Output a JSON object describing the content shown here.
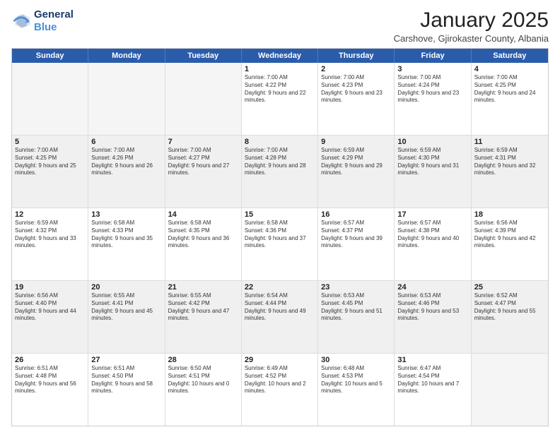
{
  "logo": {
    "line1": "General",
    "line2": "Blue"
  },
  "header": {
    "month": "January 2025",
    "location": "Carshove, Gjirokaster County, Albania"
  },
  "weekdays": [
    "Sunday",
    "Monday",
    "Tuesday",
    "Wednesday",
    "Thursday",
    "Friday",
    "Saturday"
  ],
  "rows": [
    [
      {
        "day": "",
        "info": "",
        "empty": true
      },
      {
        "day": "",
        "info": "",
        "empty": true
      },
      {
        "day": "",
        "info": "",
        "empty": true
      },
      {
        "day": "1",
        "info": "Sunrise: 7:00 AM\nSunset: 4:22 PM\nDaylight: 9 hours and 22 minutes."
      },
      {
        "day": "2",
        "info": "Sunrise: 7:00 AM\nSunset: 4:23 PM\nDaylight: 9 hours and 23 minutes."
      },
      {
        "day": "3",
        "info": "Sunrise: 7:00 AM\nSunset: 4:24 PM\nDaylight: 9 hours and 23 minutes."
      },
      {
        "day": "4",
        "info": "Sunrise: 7:00 AM\nSunset: 4:25 PM\nDaylight: 9 hours and 24 minutes."
      }
    ],
    [
      {
        "day": "5",
        "info": "Sunrise: 7:00 AM\nSunset: 4:25 PM\nDaylight: 9 hours and 25 minutes."
      },
      {
        "day": "6",
        "info": "Sunrise: 7:00 AM\nSunset: 4:26 PM\nDaylight: 9 hours and 26 minutes."
      },
      {
        "day": "7",
        "info": "Sunrise: 7:00 AM\nSunset: 4:27 PM\nDaylight: 9 hours and 27 minutes."
      },
      {
        "day": "8",
        "info": "Sunrise: 7:00 AM\nSunset: 4:28 PM\nDaylight: 9 hours and 28 minutes."
      },
      {
        "day": "9",
        "info": "Sunrise: 6:59 AM\nSunset: 4:29 PM\nDaylight: 9 hours and 29 minutes."
      },
      {
        "day": "10",
        "info": "Sunrise: 6:59 AM\nSunset: 4:30 PM\nDaylight: 9 hours and 31 minutes."
      },
      {
        "day": "11",
        "info": "Sunrise: 6:59 AM\nSunset: 4:31 PM\nDaylight: 9 hours and 32 minutes."
      }
    ],
    [
      {
        "day": "12",
        "info": "Sunrise: 6:59 AM\nSunset: 4:32 PM\nDaylight: 9 hours and 33 minutes."
      },
      {
        "day": "13",
        "info": "Sunrise: 6:58 AM\nSunset: 4:33 PM\nDaylight: 9 hours and 35 minutes."
      },
      {
        "day": "14",
        "info": "Sunrise: 6:58 AM\nSunset: 4:35 PM\nDaylight: 9 hours and 36 minutes."
      },
      {
        "day": "15",
        "info": "Sunrise: 6:58 AM\nSunset: 4:36 PM\nDaylight: 9 hours and 37 minutes."
      },
      {
        "day": "16",
        "info": "Sunrise: 6:57 AM\nSunset: 4:37 PM\nDaylight: 9 hours and 39 minutes."
      },
      {
        "day": "17",
        "info": "Sunrise: 6:57 AM\nSunset: 4:38 PM\nDaylight: 9 hours and 40 minutes."
      },
      {
        "day": "18",
        "info": "Sunrise: 6:56 AM\nSunset: 4:39 PM\nDaylight: 9 hours and 42 minutes."
      }
    ],
    [
      {
        "day": "19",
        "info": "Sunrise: 6:56 AM\nSunset: 4:40 PM\nDaylight: 9 hours and 44 minutes."
      },
      {
        "day": "20",
        "info": "Sunrise: 6:55 AM\nSunset: 4:41 PM\nDaylight: 9 hours and 45 minutes."
      },
      {
        "day": "21",
        "info": "Sunrise: 6:55 AM\nSunset: 4:42 PM\nDaylight: 9 hours and 47 minutes."
      },
      {
        "day": "22",
        "info": "Sunrise: 6:54 AM\nSunset: 4:44 PM\nDaylight: 9 hours and 49 minutes."
      },
      {
        "day": "23",
        "info": "Sunrise: 6:53 AM\nSunset: 4:45 PM\nDaylight: 9 hours and 51 minutes."
      },
      {
        "day": "24",
        "info": "Sunrise: 6:53 AM\nSunset: 4:46 PM\nDaylight: 9 hours and 53 minutes."
      },
      {
        "day": "25",
        "info": "Sunrise: 6:52 AM\nSunset: 4:47 PM\nDaylight: 9 hours and 55 minutes."
      }
    ],
    [
      {
        "day": "26",
        "info": "Sunrise: 6:51 AM\nSunset: 4:48 PM\nDaylight: 9 hours and 56 minutes."
      },
      {
        "day": "27",
        "info": "Sunrise: 6:51 AM\nSunset: 4:50 PM\nDaylight: 9 hours and 58 minutes."
      },
      {
        "day": "28",
        "info": "Sunrise: 6:50 AM\nSunset: 4:51 PM\nDaylight: 10 hours and 0 minutes."
      },
      {
        "day": "29",
        "info": "Sunrise: 6:49 AM\nSunset: 4:52 PM\nDaylight: 10 hours and 2 minutes."
      },
      {
        "day": "30",
        "info": "Sunrise: 6:48 AM\nSunset: 4:53 PM\nDaylight: 10 hours and 5 minutes."
      },
      {
        "day": "31",
        "info": "Sunrise: 6:47 AM\nSunset: 4:54 PM\nDaylight: 10 hours and 7 minutes."
      },
      {
        "day": "",
        "info": "",
        "empty": true
      }
    ]
  ]
}
